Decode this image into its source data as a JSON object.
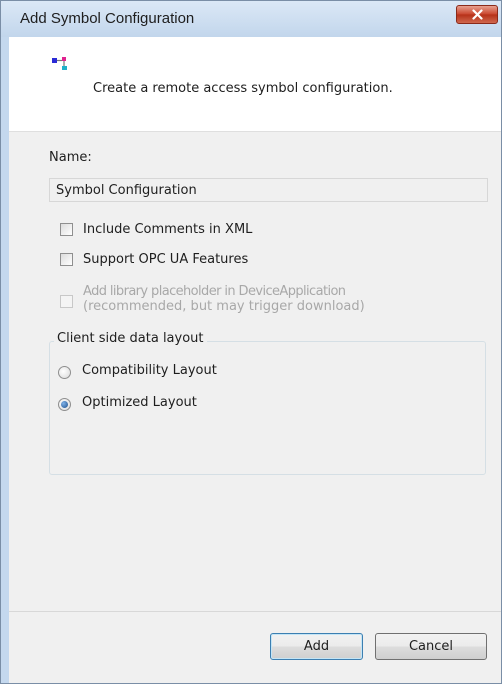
{
  "window": {
    "title": "Add Symbol Configuration",
    "close_icon": "close-x-icon"
  },
  "header": {
    "icon": "symbol-configuration-icon",
    "description": "Create a remote access symbol configuration."
  },
  "form": {
    "name_label": "Name:",
    "name_value": "Symbol Configuration",
    "include_comments": {
      "label": "Include Comments in XML",
      "checked": false
    },
    "support_opc_ua": {
      "label": "Support OPC UA Features",
      "checked": false
    },
    "library_placeholder": {
      "line1": "Add library placeholder in DeviceApplication",
      "line2": "(recommended, but may trigger download)",
      "checked": false,
      "enabled": false
    }
  },
  "layout_group": {
    "title": "Client side data layout",
    "options": [
      {
        "label": "Compatibility Layout",
        "selected": false
      },
      {
        "label": "Optimized Layout",
        "selected": true
      }
    ]
  },
  "buttons": {
    "add": "Add",
    "cancel": "Cancel"
  },
  "colors": {
    "close_button": "#c8432b",
    "title_bar": "#c2d6ec",
    "disabled_text": "#a8a8a8"
  }
}
